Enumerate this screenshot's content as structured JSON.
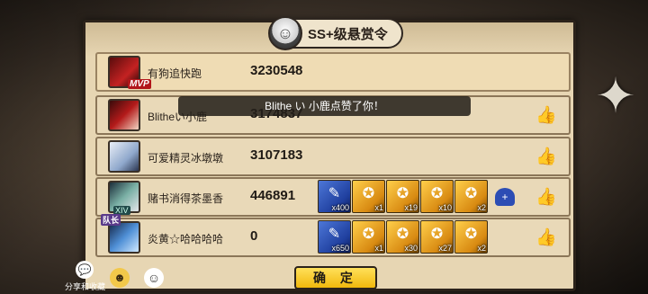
{
  "header": {
    "title": "SS+级悬赏令",
    "avatar_icon": "masked-ninja-avatar"
  },
  "toast": {
    "text": "Blithe い 小鹿点赞了你！"
  },
  "rows": [
    {
      "name": "有狗追快跑",
      "score": "3230548",
      "badge": "MVP",
      "rewards": []
    },
    {
      "name": "Blitheい小鹿",
      "score": "3174837",
      "rewards": []
    },
    {
      "name": "可爱精灵冰墩墩",
      "score": "3107183",
      "rewards": []
    },
    {
      "name": "赌书消得茶墨香",
      "score": "446891",
      "level": "XIV",
      "rewards": [
        {
          "icon": "scroll-reward-icon",
          "count": "x400",
          "color": "blue"
        },
        {
          "icon": "token-reward-icon",
          "count": "x1"
        },
        {
          "icon": "token-reward-icon",
          "count": "x19"
        },
        {
          "icon": "token-reward-icon",
          "count": "x10"
        },
        {
          "icon": "token-reward-icon",
          "count": "x2"
        }
      ]
    },
    {
      "name": "炎黄☆哈哈哈哈",
      "score": "0",
      "rank_tag": "队长",
      "rewards": [
        {
          "icon": "scroll-reward-icon",
          "count": "x650",
          "color": "blue"
        },
        {
          "icon": "token-reward-icon",
          "count": "x1"
        },
        {
          "icon": "token-reward-icon",
          "count": "x30"
        },
        {
          "icon": "token-reward-icon",
          "count": "x27"
        },
        {
          "icon": "token-reward-icon",
          "count": "x2"
        }
      ]
    }
  ],
  "buttons": {
    "confirm": "确 定"
  },
  "footer": {
    "share_label": "分享和收藏"
  },
  "colors": {
    "panel": "#e7d6b3",
    "confirm": "#f1b80c",
    "mvp": "#b2161b"
  }
}
